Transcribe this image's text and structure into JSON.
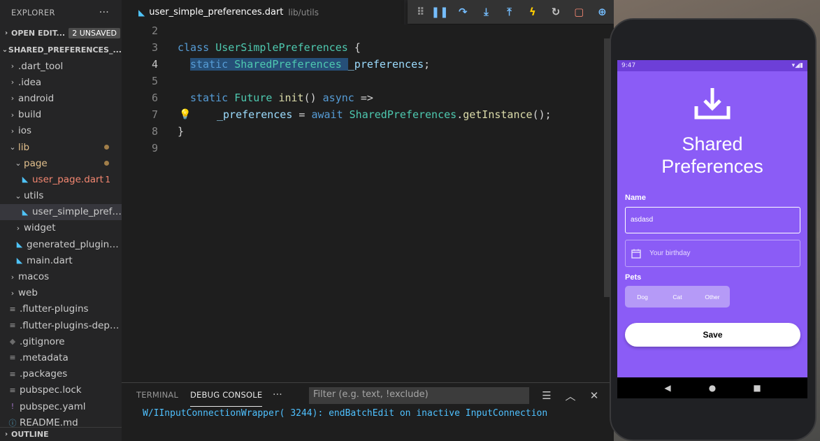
{
  "explorer": {
    "title": "EXPLORER",
    "more": "···",
    "open_editors": {
      "label": "OPEN EDIT...",
      "badge": "2 UNSAVED"
    },
    "project": {
      "label": "SHARED_PREFERENCES_..."
    },
    "items": [
      {
        "label": ".dart_tool",
        "chev": "›"
      },
      {
        "label": ".idea",
        "chev": "›"
      },
      {
        "label": "android",
        "chev": "›"
      },
      {
        "label": "build",
        "chev": "›"
      },
      {
        "label": "ios",
        "chev": "›"
      },
      {
        "label": "lib",
        "chev": "⌄"
      },
      {
        "label": "page",
        "chev": "⌄"
      },
      {
        "label": "user_page.dart",
        "count": "1"
      },
      {
        "label": "utils",
        "chev": "⌄"
      },
      {
        "label": "user_simple_prefer..."
      },
      {
        "label": "widget",
        "chev": "›"
      },
      {
        "label": "generated_plugin_r..."
      },
      {
        "label": "main.dart"
      },
      {
        "label": "macos",
        "chev": "›"
      },
      {
        "label": "web",
        "chev": "›"
      },
      {
        "label": ".flutter-plugins"
      },
      {
        "label": ".flutter-plugins-depe..."
      },
      {
        "label": ".gitignore"
      },
      {
        "label": ".metadata"
      },
      {
        "label": ".packages"
      },
      {
        "label": "pubspec.lock"
      },
      {
        "label": "pubspec.yaml"
      },
      {
        "label": "README.md"
      }
    ],
    "outline": "OUTLINE"
  },
  "tab": {
    "filename": "user_simple_preferences.dart",
    "path": "lib/utils"
  },
  "editor": {
    "line_numbers": [
      "2",
      "3",
      "4",
      "5",
      "6",
      "7",
      "8",
      "9"
    ],
    "line3": {
      "kw": "class",
      "name": "UserSimplePreferences",
      "brace": "{"
    },
    "line4": {
      "kw": "static",
      "type": "SharedPreferences",
      "var": "_preferences",
      "end": ";"
    },
    "line6": {
      "kw": "static",
      "type": "Future",
      "fn": "init",
      "parens": "()",
      "async": "async",
      "arrow": "=>"
    },
    "line7": {
      "var": "_preferences",
      "eq": "=",
      "await": "await",
      "type": "SharedPreferences",
      "dot": ".",
      "fn": "getInstance",
      "end": "();"
    },
    "line8": {
      "brace": "}"
    }
  },
  "panel": {
    "tab_terminal": "TERMINAL",
    "tab_debug": "DEBUG CONSOLE",
    "more": "···",
    "filter_placeholder": "Filter (e.g. text, !exclude)",
    "console_output": "W/IInputConnectionWrapper( 3244): endBatchEdit on inactive InputConnection"
  },
  "phone": {
    "status_time": "9:47",
    "status_right": "▾◢▮",
    "title_line1": "Shared",
    "title_line2": "Preferences",
    "name_label": "Name",
    "name_value": "asdasd",
    "birthday_placeholder": "Your birthday",
    "pets_label": "Pets",
    "pets_options": [
      "Dog",
      "Cat",
      "Other"
    ],
    "save_label": "Save"
  },
  "colors": {
    "app_primary": "#8b5cf6",
    "status_bar": "#6d3fd8",
    "editor_bg": "#1e1e1e",
    "sidebar_bg": "#252526"
  }
}
